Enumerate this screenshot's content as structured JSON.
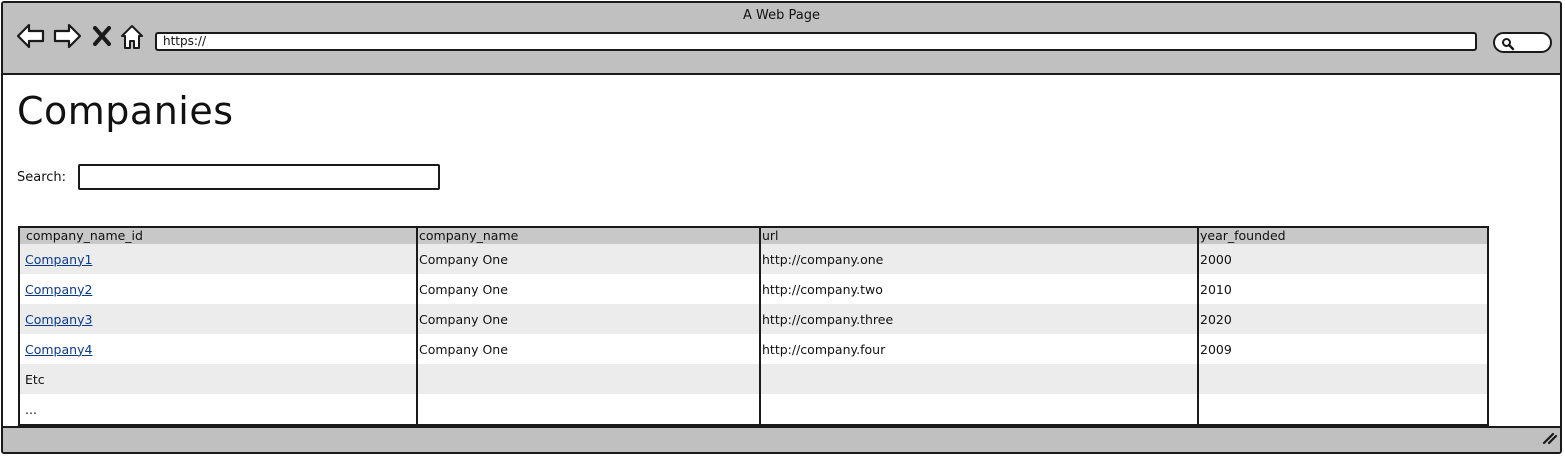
{
  "window": {
    "title": "A Web Page"
  },
  "toolbar": {
    "icons": [
      "back-arrow-icon",
      "forward-arrow-icon",
      "close-x-icon",
      "home-icon",
      "search-icon",
      "resize-grip-icon"
    ],
    "url": "https://"
  },
  "page": {
    "title": "Companies",
    "search_label": "Search:",
    "search_value": ""
  },
  "table": {
    "columns": [
      "company_name_id",
      "company_name",
      "url",
      "year_founded"
    ],
    "rows": [
      [
        "Company1",
        "Company One",
        "http://company.one",
        "2000"
      ],
      [
        "Company2",
        "Company One",
        "http://company.two",
        "2010"
      ],
      [
        "Company3",
        "Company One",
        "http://company.three",
        "2020"
      ],
      [
        "Company4",
        "Company One",
        "http://company.four",
        "2009"
      ],
      [
        "Etc",
        "",
        "",
        ""
      ],
      [
        "...",
        "",
        "",
        ""
      ]
    ]
  },
  "colors": {
    "chrome": "#c0c0c0",
    "header_row": "#c8c8c8",
    "stripe": "#ececec",
    "link": "#0b3a8d",
    "border": "#1a1a1a"
  }
}
